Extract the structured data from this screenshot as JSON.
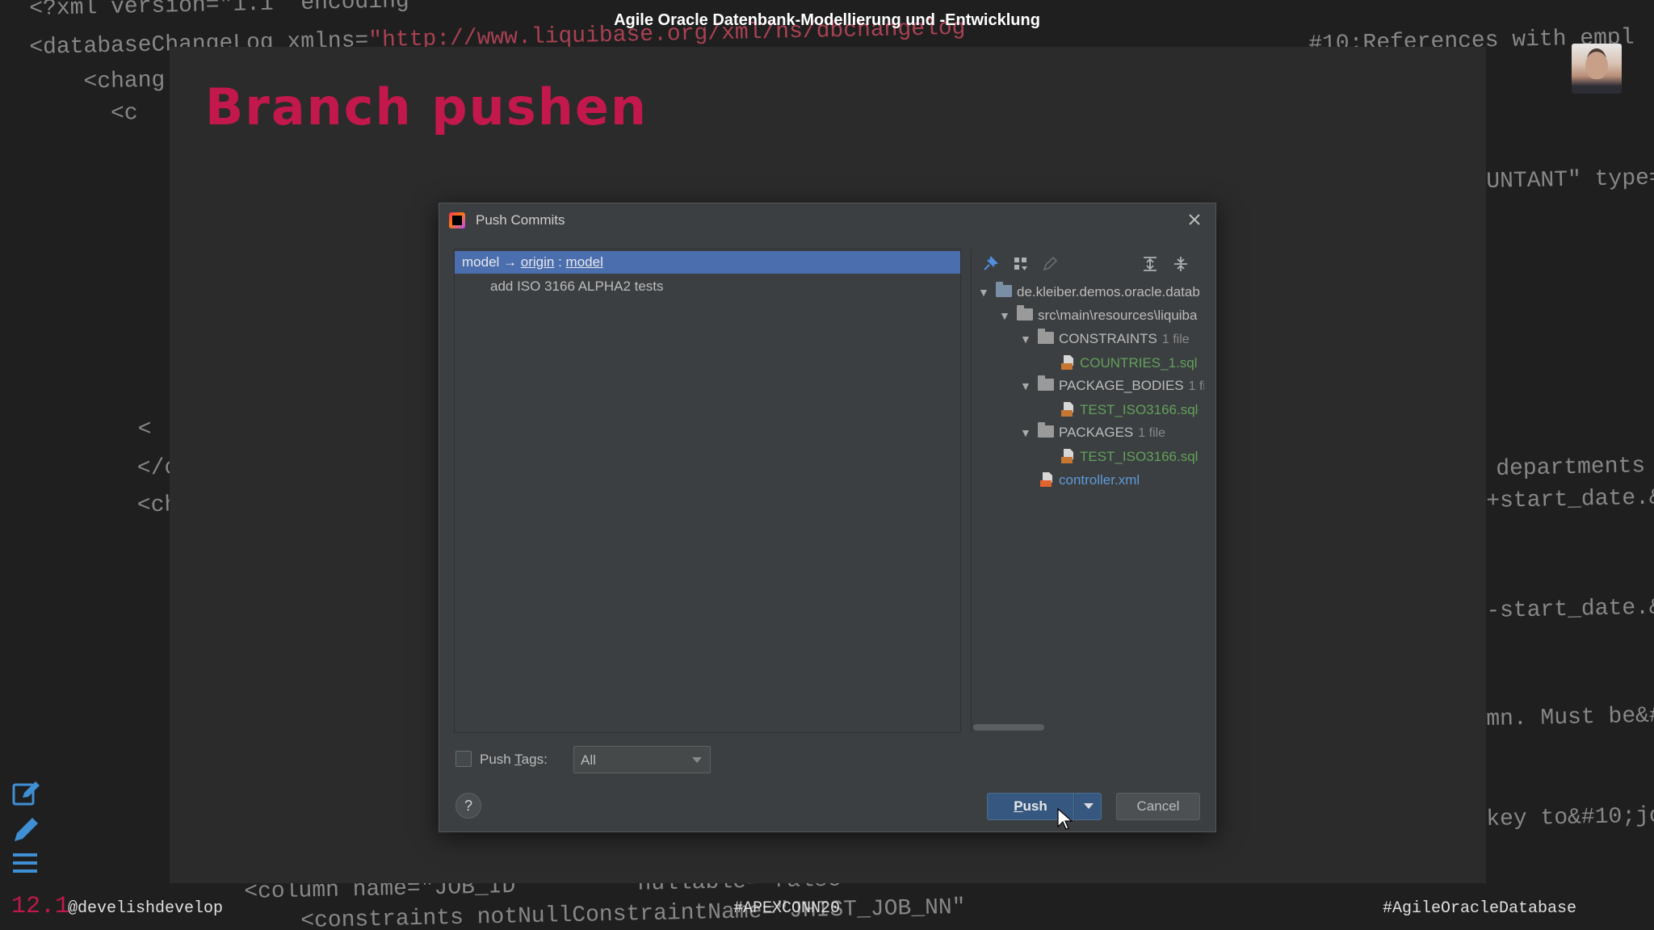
{
  "header": {
    "caption": "Agile Oracle Datenbank-Modellierung und -Entwicklung"
  },
  "slide": {
    "title": "Branch pushen"
  },
  "background_code": [
    {
      "text": "<?xml version=\"1.1\" encoding",
      "string": ""
    },
    {
      "text": "<databaseChangeLog xmlns=",
      "string": "\"http://www.liquibase.org/xml/ns/dbchangelog"
    },
    {
      "text": "    <chang",
      "string": ""
    },
    {
      "text": "      <c",
      "string": ""
    },
    {
      "text": "        <",
      "string": ""
    },
    {
      "text": "  </cha",
      "string": ""
    },
    {
      "text": "  <cha",
      "string": ""
    }
  ],
  "background_code_right": [
    "#10;References with empl",
    "UNTANT\" type=",
    "departments",
    "+start_date.&",
    "-start_date.&",
    "mn. Must be&#",
    "key to&#10;jo"
  ],
  "background_code_bottom": [
    "<column name=\"JOB_ID\"        nullable=\"false\"",
    "<constraints notNullConstraintName=\"JHIST_JOB_NN\""
  ],
  "dialog": {
    "title": "Push Commits",
    "branch": {
      "local": "model",
      "arrow": "→",
      "remote": "origin",
      "separator": " : ",
      "target": "model"
    },
    "commits": [
      "add ISO 3166 ALPHA2 tests"
    ],
    "tree": {
      "root": "de.kleiber.demos.oracle.datab",
      "path": "src\\main\\resources\\liquiba",
      "folders": [
        {
          "name": "CONSTRAINTS",
          "count": "1 file",
          "file": "COUNTRIES_1.sql"
        },
        {
          "name": "PACKAGE_BODIES",
          "count": "1 fil",
          "file": "TEST_ISO3166.sql"
        },
        {
          "name": "PACKAGES",
          "count": "1 file",
          "file": "TEST_ISO3166.sql"
        }
      ],
      "loose_file": "controller.xml"
    },
    "push_tags_label_pre": "Push ",
    "push_tags_label_u": "T",
    "push_tags_label_post": "ags:",
    "push_tags_value": "All",
    "help_label": "?",
    "push_label_u": "P",
    "push_label_rest": "ush",
    "cancel_label": "Cancel"
  },
  "footer": {
    "slide_number": "12.1",
    "handle": "@develishdevelop",
    "hashtag_conference": "#APEXCONN20",
    "hashtag_topic": "#AgileOracleDatabase"
  },
  "colors": {
    "accent_title": "#c2184b",
    "selection": "#4b6eaf",
    "dialog_bg": "#3c3f41",
    "added_file": "#62a05a",
    "modified_file": "#5c9ad8",
    "primary_button": "#365880"
  }
}
